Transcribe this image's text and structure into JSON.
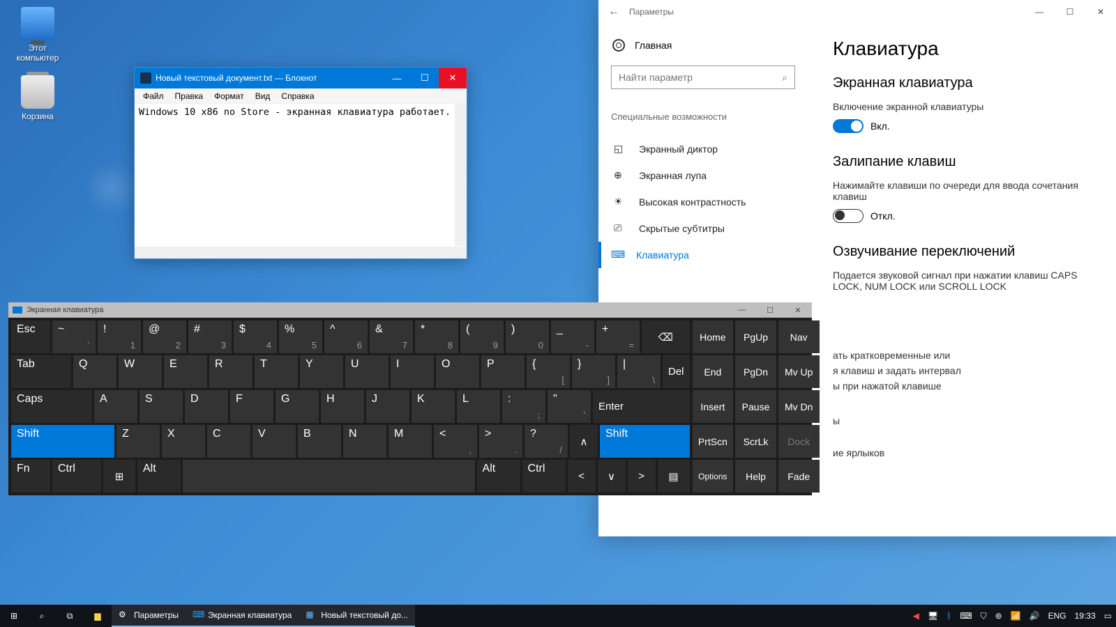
{
  "desktop": {
    "icons": {
      "this_pc": "Этот\nкомпьютер",
      "recycle": "Корзина"
    }
  },
  "notepad": {
    "title": "Новый текстовый документ.txt — Блокнот",
    "menus": [
      "Файл",
      "Правка",
      "Формат",
      "Вид",
      "Справка"
    ],
    "content": "Windows 10 x86 no Store - экранная клавиатура работает."
  },
  "settings": {
    "window_label": "Параметры",
    "home": "Главная",
    "search_placeholder": "Найти параметр",
    "category": "Специальные возможности",
    "items": [
      {
        "label": "Экранный диктор"
      },
      {
        "label": "Экранная лупа"
      },
      {
        "label": "Высокая контрастность"
      },
      {
        "label": "Скрытые субтитры"
      },
      {
        "label": "Клавиатура",
        "active": true
      }
    ],
    "page": {
      "h1": "Клавиатура",
      "osk_h": "Экранная клавиатура",
      "osk_t": "Включение экранной клавиатуры",
      "osk_state": "Вкл.",
      "sticky_h": "Залипание клавиш",
      "sticky_t": "Нажимайте клавиши по очереди для ввода сочетания клавиш",
      "sticky_state": "Откл.",
      "tone_h": "Озвучивание переключений",
      "tone_t": "Подается звуковой сигнал при нажатии клавиш CAPS LOCK, NUM LOCK или SCROLL LOCK",
      "partial1": "ать кратковременные или",
      "partial2": "я клавиш и задать интервал",
      "partial3": "ы при нажатой клавише",
      "partial4": "ы",
      "partial5": "ие ярлыков"
    }
  },
  "osk": {
    "title": "Экранная клавиатура",
    "nav": {
      "r1": [
        "Home",
        "PgUp",
        "Nav"
      ],
      "r2": [
        "End",
        "PgDn",
        "Mv Up"
      ],
      "r3": [
        "Insert",
        "Pause",
        "Mv Dn"
      ],
      "r4": [
        "PrtScn",
        "ScrLk",
        "Dock"
      ],
      "r5": [
        "Options",
        "Help",
        "Fade"
      ]
    }
  },
  "taskbar": {
    "apps": [
      {
        "label": "Параметры"
      },
      {
        "label": "Экранная клавиатура"
      },
      {
        "label": "Новый текстовый до..."
      }
    ],
    "lang": "ENG",
    "time": "19:33"
  }
}
